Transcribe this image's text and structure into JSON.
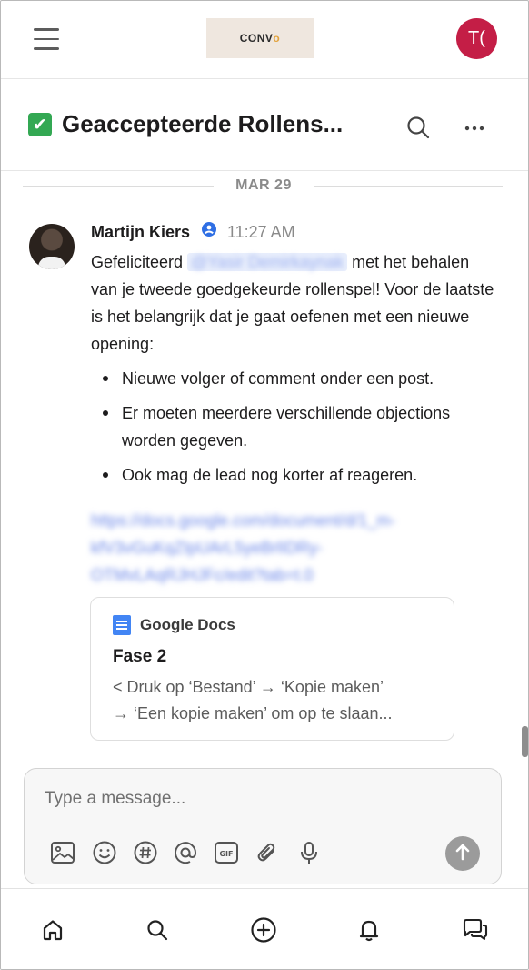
{
  "app": {
    "logo_text": "CONV",
    "logo_accent": "o",
    "user_initials": "T(",
    "avatar_color": "#c41e46"
  },
  "channel": {
    "title": "Geaccepteerde Rollens...",
    "emoji": "✔",
    "icons": [
      "search-icon",
      "more-icon"
    ]
  },
  "date_divider": "MAR 29",
  "message": {
    "author": "Martijn Kiers",
    "verified": true,
    "time": "11:27 AM",
    "greeting": "Gefeliciteerd",
    "mention": "@Yasir Demirkaynak",
    "body_rest": "met het behalen van je tweede goedgekeurde rollenspel! Voor de laatste is het belangrijk dat je gaat oefenen met een nieuwe opening:",
    "bullets": [
      "Nieuwe volger of comment onder een post.",
      "Er moeten meerdere verschillende objections worden gegeven.",
      "Ook mag de lead nog korter af reageren."
    ],
    "link": "https://docs.google.com/document/d/1_m-kfV3vGuKqZIpUArL5yeBrlIDRy-OTMvLAqRJHJFc/edit?tab=t.0"
  },
  "doc_card": {
    "source": "Google Docs",
    "title": "Fase 2",
    "description_line1": "< Druk op ‘Bestand’ → ‘Kopie maken’",
    "description_line2": "→ ‘Een kopie maken’ om op te slaan..."
  },
  "composer": {
    "placeholder": "Type a message...",
    "tools": [
      "image-icon",
      "emoji-icon",
      "hashtag-icon",
      "mention-icon",
      "gif-icon",
      "attachment-icon",
      "microphone-icon"
    ],
    "send_icon": "send-arrow-icon"
  },
  "bottom_nav": [
    "home-icon",
    "search-icon",
    "add-icon",
    "notifications-icon",
    "messages-icon"
  ]
}
